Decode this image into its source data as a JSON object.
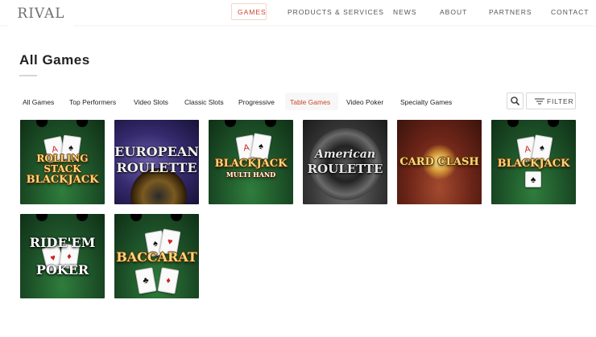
{
  "header": {
    "logo": "RIVAL",
    "nav": [
      {
        "label": "GAMES",
        "active": true
      },
      {
        "label": "PRODUCTS & SERVICES",
        "active": false
      },
      {
        "label": "NEWS",
        "active": false
      },
      {
        "label": "ABOUT",
        "active": false
      },
      {
        "label": "PARTNERS",
        "active": false
      },
      {
        "label": "CONTACT",
        "active": false
      }
    ]
  },
  "page": {
    "title": "All Games"
  },
  "tabs": [
    {
      "label": "All Games",
      "active": false
    },
    {
      "label": "Top Performers",
      "active": false
    },
    {
      "label": "Video Slots",
      "active": false
    },
    {
      "label": "Classic Slots",
      "active": false
    },
    {
      "label": "Progressive",
      "active": false
    },
    {
      "label": "Table Games",
      "active": true
    },
    {
      "label": "Video Poker",
      "active": false
    },
    {
      "label": "Specialty Games",
      "active": false
    }
  ],
  "controls": {
    "search_icon": "search-icon",
    "filter_icon": "filter-lines-icon",
    "filter_label": "FILTER"
  },
  "games": [
    {
      "title_lines": [
        "ROLLING",
        "STACK",
        "BLACKJACK"
      ]
    },
    {
      "title_lines": [
        "EUROPEAN",
        "ROULETTE"
      ]
    },
    {
      "title_lines": [
        "BLACKJACK",
        "MULTI HAND"
      ]
    },
    {
      "title_lines": [
        "American",
        "ROULETTE"
      ]
    },
    {
      "title_lines": [
        "CARD CLASH"
      ]
    },
    {
      "title_lines": [
        "BLACKJACK"
      ]
    },
    {
      "title_lines": [
        "RIDE'EM",
        "POKER"
      ]
    },
    {
      "title_lines": [
        "BACCARAT"
      ]
    }
  ],
  "colors": {
    "accent": "#c9472b",
    "text": "#222222"
  }
}
